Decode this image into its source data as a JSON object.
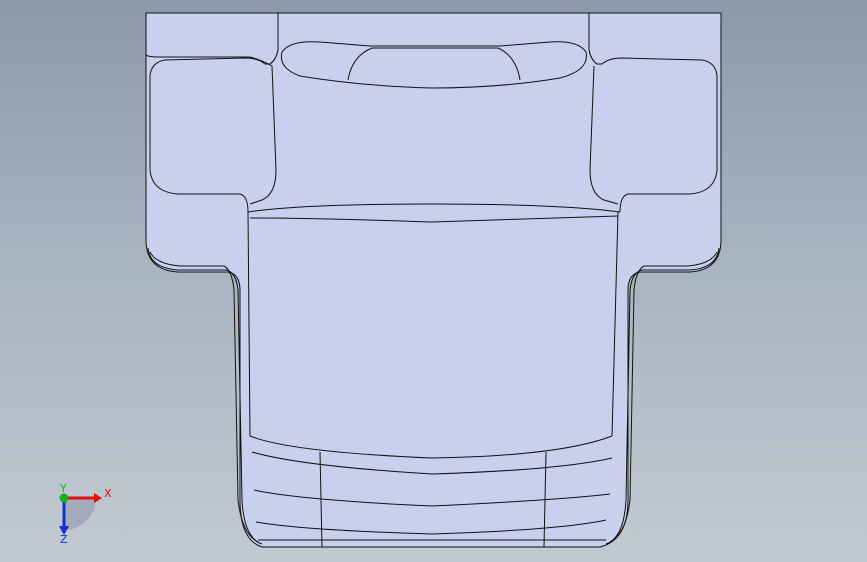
{
  "viewport": {
    "background_top": "#8b99aa",
    "background_bottom": "#c2c9d1"
  },
  "model": {
    "fill_color": "#c9d0ee",
    "edge_color": "#111111"
  },
  "triad": {
    "x_label": "X",
    "y_label": "Y",
    "z_label": "Z",
    "x_color": "#e01010",
    "y_color": "#18b018",
    "z_color": "#1030d0"
  }
}
